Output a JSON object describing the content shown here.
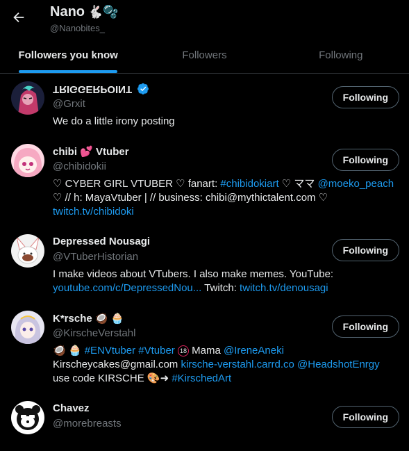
{
  "header": {
    "title": "Nano",
    "title_emoji": "🐇🫧",
    "handle": "@Nanobites_"
  },
  "tabs": [
    {
      "label": "Followers you know"
    },
    {
      "label": "Followers"
    },
    {
      "label": "Following"
    }
  ],
  "users": [
    {
      "name": "TRIGGERPOINT",
      "handle": "@Grxit",
      "button": "Following",
      "bio": "We do a little irony posting"
    },
    {
      "name": "chibi",
      "name_suffix": "Vtuber",
      "handle": "@chibidokii",
      "button": "Following",
      "bio_parts": {
        "p1": "♡ CYBER GIRL VTUBER ♡ fanart: ",
        "l1": "#chibidokiart",
        "p2": " ♡ ママ ",
        "l2": "@moeko_peach",
        "p3": " ♡ // h: MayaVtuber | // business: chibi@mythictalent.com ♡ ",
        "l3": "twitch.tv/chibidoki"
      }
    },
    {
      "name": "Depressed Nousagi",
      "handle": "@VTuberHistorian",
      "button": "Following",
      "bio_parts": {
        "p1": "I make videos about VTubers. I also make memes. YouTube: ",
        "l1": "youtube.com/c/DepressedNou...",
        "p2": " Twitch: ",
        "l2": "twitch.tv/denousagi"
      }
    },
    {
      "name": "K*rsche",
      "name_emoji": "🥥 🧁",
      "handle": "@KirscheVerstahl",
      "button": "Following",
      "bio_parts": {
        "e1": "🥥 🧁 ",
        "l1": "#ENVtuber",
        "l2": "#Vtuber",
        "p1": " Mama ",
        "l3": "@IreneAneki",
        "p2": "Kirscheycakes@gmail.com ",
        "l4": "kirsche-verstahl.carrd.co",
        "l5": "@HeadshotEnrgy",
        "p3": "use code KIRSCHE 🎨➜ ",
        "l6": "#KirschedArt"
      }
    },
    {
      "name": "Chavez",
      "handle": "@morebreasts",
      "button": "Following"
    }
  ],
  "colors": {
    "accent": "#1d9bf0",
    "muted": "#71767b",
    "text": "#e7e9ea",
    "border": "#2f3336"
  }
}
